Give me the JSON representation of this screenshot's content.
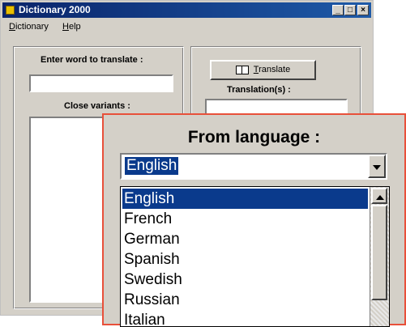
{
  "window": {
    "title": "Dictionary 2000",
    "controls": [
      "minimize",
      "maximize",
      "close"
    ]
  },
  "menu": {
    "items": [
      {
        "label": "Dictionary",
        "mnemonic": "D",
        "rest": "ictionary"
      },
      {
        "label": "Help",
        "mnemonic": "H",
        "rest": "elp"
      }
    ]
  },
  "left_panel": {
    "enter_label": "Enter word to translate :",
    "word_input_value": "",
    "close_variants_label": "Close variants :"
  },
  "right_panel": {
    "translate_button": {
      "mnemonic": "T",
      "rest": "ranslate",
      "label": "Translate"
    },
    "translations_label": "Translation(s) :"
  },
  "from_language": {
    "heading": "From  language :",
    "selected": "English",
    "options": [
      "English",
      "French",
      "German",
      "Spanish",
      "Swedish",
      "Russian",
      "Italian"
    ],
    "highlighted_index": 0
  },
  "icons": {
    "app": "dictionary-app-icon",
    "translate": "book-icon",
    "dropdown": "chevron-down-icon",
    "scroll_up": "scroll-up-arrow-icon"
  },
  "colors": {
    "selection": "#0a3a8c",
    "callout_border": "#e8503a",
    "window_face": "#d4d0c8"
  }
}
